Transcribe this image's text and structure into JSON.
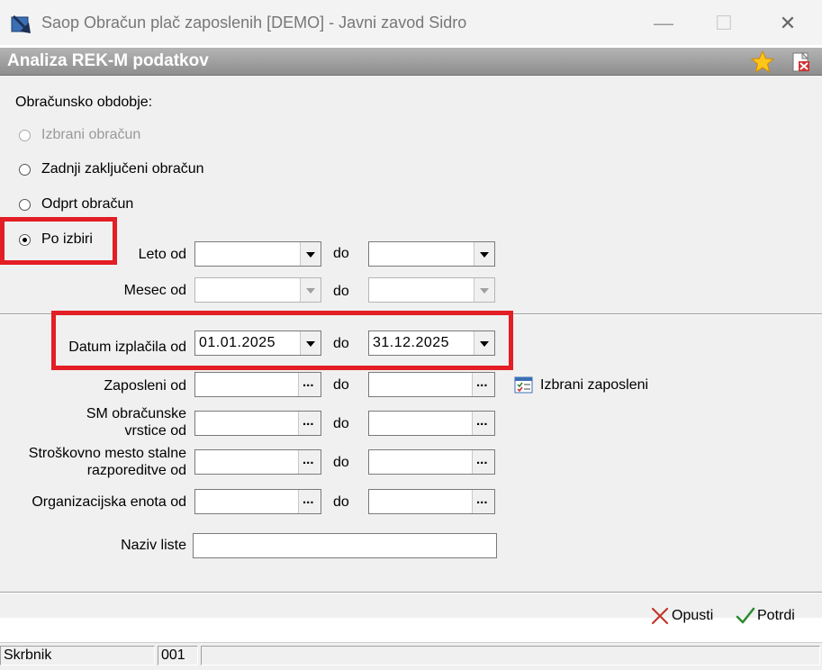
{
  "window": {
    "title": "Saop Obračun plač zaposlenih [DEMO] - Javni zavod Sidro",
    "minimize": "—",
    "maximize": "☐",
    "close": "✕"
  },
  "header": {
    "title": "Analiza REK-M podatkov"
  },
  "period": {
    "label": "Obračunsko obdobje:",
    "options": [
      {
        "label": "Izbrani obračun",
        "state": "disabled"
      },
      {
        "label": "Zadnji zaključeni obračun",
        "state": "unchecked"
      },
      {
        "label": "Odprt obračun",
        "state": "unchecked"
      },
      {
        "label": "Po izbiri",
        "state": "checked"
      }
    ]
  },
  "fields": {
    "do_label": "do",
    "leto_label": "Leto od",
    "leto_od": "",
    "leto_do": "",
    "mesec_label": "Mesec od",
    "mesec_od": "",
    "mesec_do": "",
    "datum_label": "Datum izplačila od",
    "datum_od": "01.01.2025",
    "datum_do": "31.12.2025",
    "zaposleni_label": "Zaposleni od",
    "izbrani_zaposleni_label": "Izbrani zaposleni",
    "sm_label_1": "SM obračunske",
    "sm_label_2": "vrstice od",
    "sm_stalne_label_1": "Stroškovno mesto stalne",
    "sm_stalne_label_2": "razporeditve od",
    "oe_label": "Organizacijska enota od",
    "naziv_label": "Naziv liste",
    "naziv_value": ""
  },
  "actions": {
    "cancel_label": "Opusti",
    "confirm_label": "Potrdi"
  },
  "status": {
    "user": "Skrbnik",
    "code": "001"
  },
  "colors": {
    "highlight": "#e31e24",
    "header_bg": "#9c9c9c",
    "form_bg": "#f0f0f0"
  }
}
